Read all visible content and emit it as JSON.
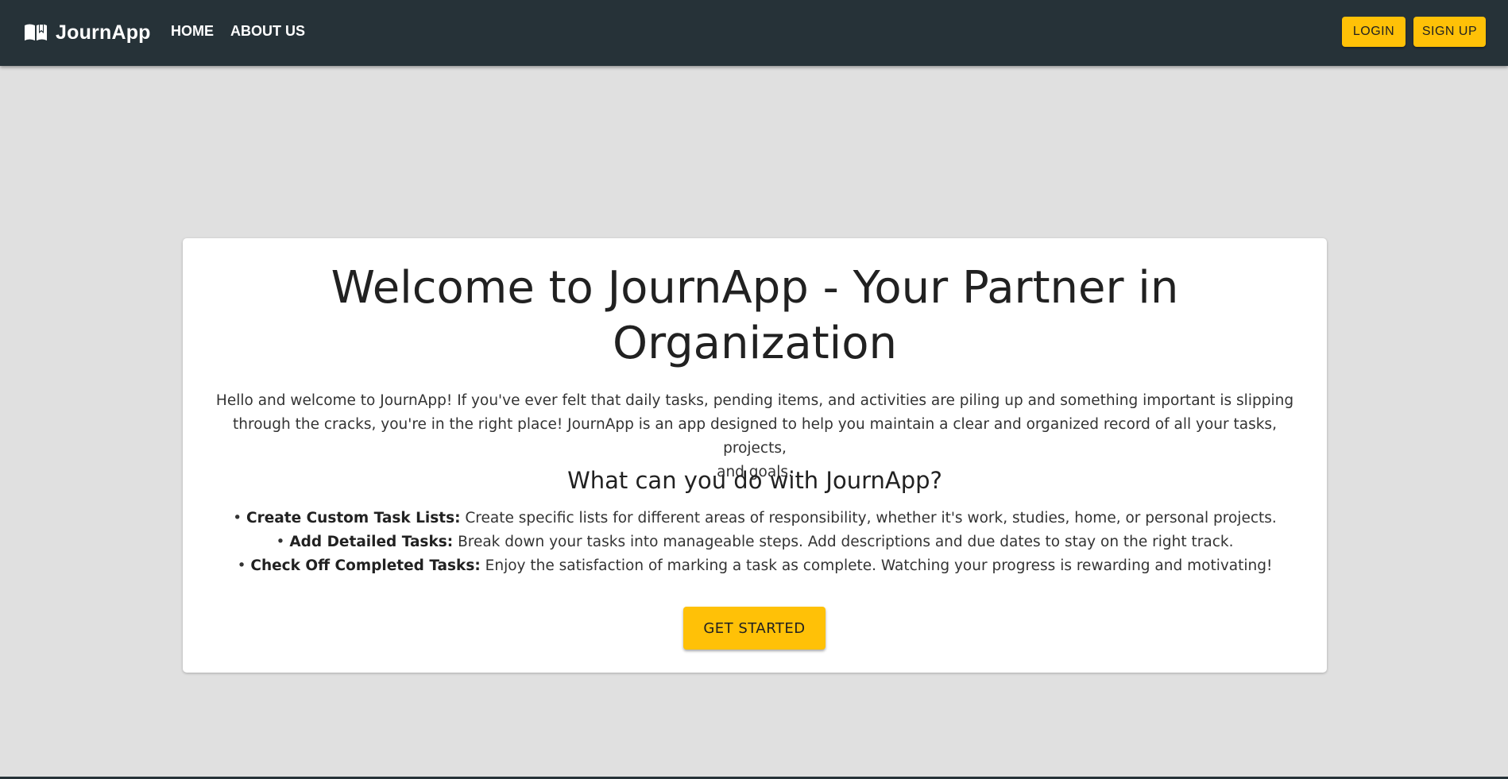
{
  "navbar": {
    "brand_icon": "open-book-icon",
    "brand_name": "JournApp",
    "links": [
      "HOME",
      "ABOUT US"
    ],
    "login_label": "LOGIN",
    "signup_label": "SIGN UP",
    "background_color": "#263238",
    "accent_color": "#ffc107"
  },
  "card": {
    "title_line1": "Welcome to JournApp - Your Partner in",
    "title_line2": "Organization",
    "intro_line1": "Hello and welcome to JournApp! If you've ever felt that daily tasks, pending items, and activities are piling up and something important is slipping",
    "intro_line2": "through the cracks, you're in the right place! JournApp is an app designed to help you maintain a clear and organized record of all your tasks, projects,",
    "intro_line3": "and goals.",
    "subtitle": "What can you do with JournApp?",
    "features": [
      {
        "bullet": "•",
        "title": "Create Custom Task Lists:",
        "text": "Create specific lists for different areas of responsibility, whether it's work, studies, home, or personal projects."
      },
      {
        "bullet": "•",
        "title": "Add Detailed Tasks:",
        "text": "Break down your tasks into manageable steps. Add descriptions and due dates to stay on the right track."
      },
      {
        "bullet": "•",
        "title": "Check Off Completed Tasks:",
        "text": "Enjoy the satisfaction of marking a task as complete. Watching your progress is rewarding and motivating!"
      }
    ],
    "cta_label": "GET STARTED"
  },
  "page": {
    "background_color": "#e0e0e0"
  }
}
